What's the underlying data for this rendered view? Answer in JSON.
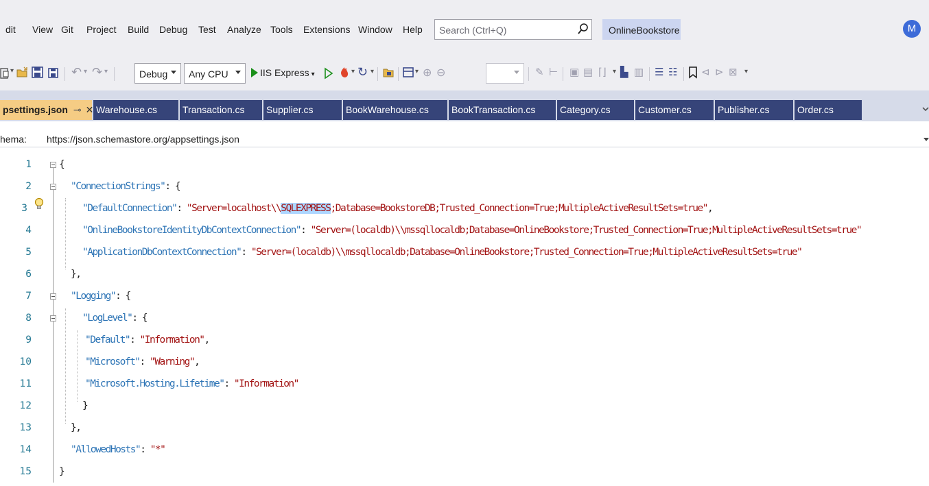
{
  "menu": [
    "dit",
    "View",
    "Git",
    "Project",
    "Build",
    "Debug",
    "Test",
    "Analyze",
    "Tools",
    "Extensions",
    "Window",
    "Help"
  ],
  "search": {
    "placeholder": "Search (Ctrl+Q)"
  },
  "solution_name": "OnlineBookstore",
  "user_initial": "M",
  "toolbar": {
    "configuration": "Debug",
    "platform": "Any CPU",
    "run_target": "IIS Express"
  },
  "tabs": [
    {
      "label": "psettings.json",
      "active": true
    },
    {
      "label": "Warehouse.cs"
    },
    {
      "label": "Transaction.cs"
    },
    {
      "label": "Supplier.cs"
    },
    {
      "label": "BookWarehouse.cs"
    },
    {
      "label": "BookTransaction.cs"
    },
    {
      "label": "Category.cs"
    },
    {
      "label": "Customer.cs"
    },
    {
      "label": "Publisher.cs"
    },
    {
      "label": "Order.cs"
    }
  ],
  "schema": {
    "label": "hema:",
    "url": "https://json.schemastore.org/appsettings.json"
  },
  "editor": {
    "line_numbers": [
      "1",
      "2",
      "3",
      "4",
      "5",
      "6",
      "7",
      "8",
      "9",
      "10",
      "11",
      "12",
      "13",
      "14",
      "15"
    ],
    "code": {
      "l1": "{",
      "l2k": "\"ConnectionStrings\"",
      "l2p": ": {",
      "l3k": "\"DefaultConnection\"",
      "l3c": ": ",
      "l3a": "\"Server=localhost\\\\",
      "l3h": "SQLEXPRESS",
      "l3b": ";Database=BookstoreDB;Trusted_Connection=True;MultipleActiveResultSets=true\"",
      "l3e": ",",
      "l4k": "\"OnlineBookstoreIdentityDbContextConnection\"",
      "l4c": ": ",
      "l4v": "\"Server=(localdb)\\\\mssqllocaldb;Database=OnlineBookstore;Trusted_Connection=True;MultipleActiveResultSets=true\"",
      "l5k": "\"ApplicationDbContextConnection\"",
      "l5c": ": ",
      "l5v": "\"Server=(localdb)\\\\mssqllocaldb;Database=OnlineBookstore;Trusted_Connection=True;MultipleActiveResultSets=true\"",
      "l6": "},",
      "l7k": "\"Logging\"",
      "l7p": ": {",
      "l8k": "\"LogLevel\"",
      "l8p": ": {",
      "l9k": "\"Default\"",
      "l9c": ": ",
      "l9v": "\"Information\"",
      "l9e": ",",
      "l10k": "\"Microsoft\"",
      "l10c": ": ",
      "l10v": "\"Warning\"",
      "l10e": ",",
      "l11k": "\"Microsoft.Hosting.Lifetime\"",
      "l11c": ": ",
      "l11v": "\"Information\"",
      "l12": "}",
      "l13": "},",
      "l14k": "\"AllowedHosts\"",
      "l14c": ": ",
      "l14v": "\"*\"",
      "l15": "}"
    }
  },
  "colors": {
    "menubar_bg": "#eeeef2",
    "tab_bg": "#364479",
    "active_tab_bg": "#f5cc84",
    "json_key": "#2e75b6",
    "json_string": "#a31515",
    "line_number": "#237893",
    "selection_highlight": "#add6ff"
  }
}
